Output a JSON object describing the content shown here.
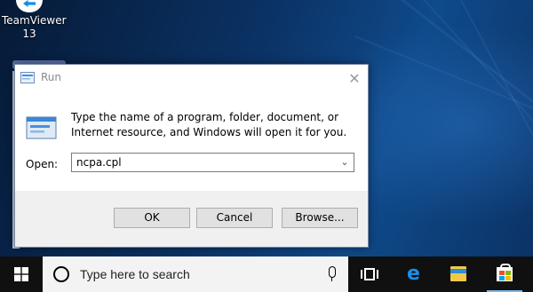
{
  "desktop": {
    "icons": [
      {
        "label_line1": "TeamViewer",
        "label_line2": "13"
      }
    ]
  },
  "dialog": {
    "title": "Run",
    "description": "Type the name of a program, folder, document, or Internet resource, and Windows will open it for you.",
    "open_label": "Open:",
    "open_value": "ncpa.cpl",
    "buttons": {
      "ok": "OK",
      "cancel": "Cancel",
      "browse": "Browse..."
    }
  },
  "taskbar": {
    "search_placeholder": "Type here to search"
  },
  "colors": {
    "accent_blue": "#0078d7",
    "taskbar_bg": "#101010",
    "dialog_bg": "#f0f0f0"
  }
}
